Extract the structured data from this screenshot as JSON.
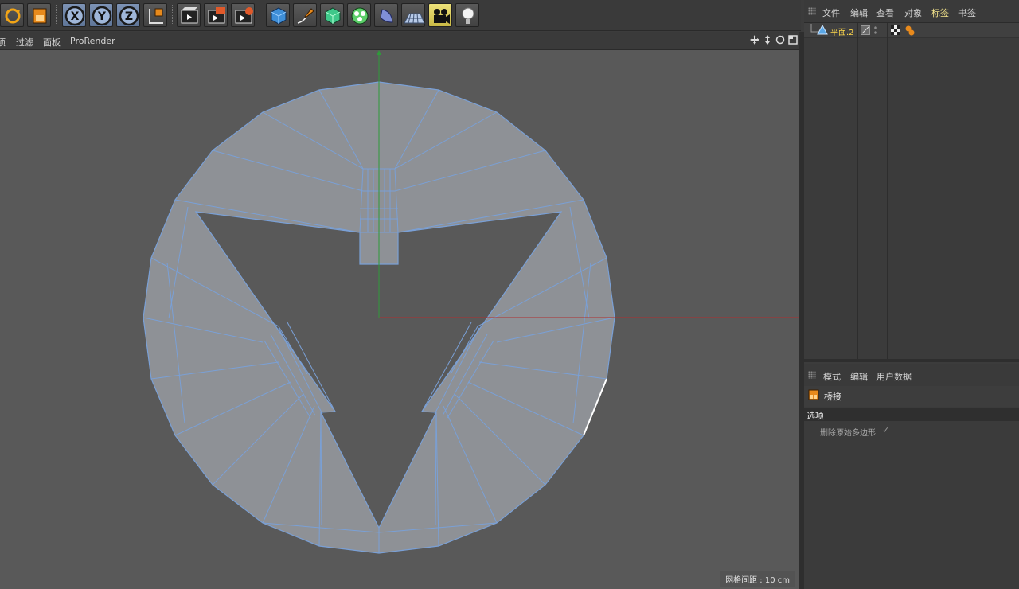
{
  "toolbar": {
    "buttons": [
      {
        "name": "live-selection-icon"
      },
      {
        "name": "model-mode-icon"
      },
      {
        "name": "x-axis-lock-button",
        "label": "X"
      },
      {
        "name": "y-axis-lock-button",
        "label": "Y"
      },
      {
        "name": "z-axis-lock-button",
        "label": "Z"
      },
      {
        "name": "coordinate-system-icon"
      },
      {
        "name": "render-view-icon"
      },
      {
        "name": "render-picture-viewer-icon"
      },
      {
        "name": "render-settings-icon"
      },
      {
        "name": "cube-icon"
      },
      {
        "name": "pen-spline-icon"
      },
      {
        "name": "subdivision-surface-icon"
      },
      {
        "name": "cloner-icon"
      },
      {
        "name": "deformer-icon"
      },
      {
        "name": "floor-icon"
      },
      {
        "name": "camera-icon"
      },
      {
        "name": "light-icon"
      }
    ]
  },
  "viewport": {
    "menu": [
      "项",
      "过滤",
      "面板",
      "ProRender"
    ],
    "grid_label": "网格间距 : 10 cm"
  },
  "object_manager": {
    "menu": [
      "文件",
      "编辑",
      "查看",
      "对象",
      "标签",
      "书签"
    ],
    "active_menu": "标签",
    "object_name": "平面.2"
  },
  "attribute_manager": {
    "menu": [
      "模式",
      "编辑",
      "用户数据"
    ],
    "tool_name": "桥接",
    "section": "选项",
    "option_label": "删除原始多边形",
    "option_checked": "✓"
  },
  "colors": {
    "viewport_bg": "#595959",
    "mesh_fill": "#8e9196",
    "mesh_edge": "#7aa0d6",
    "x_axis": "#b03030",
    "y_axis": "#2f9a3a",
    "active_menu": "#f0e08a",
    "object_label": "#ffd84a"
  }
}
